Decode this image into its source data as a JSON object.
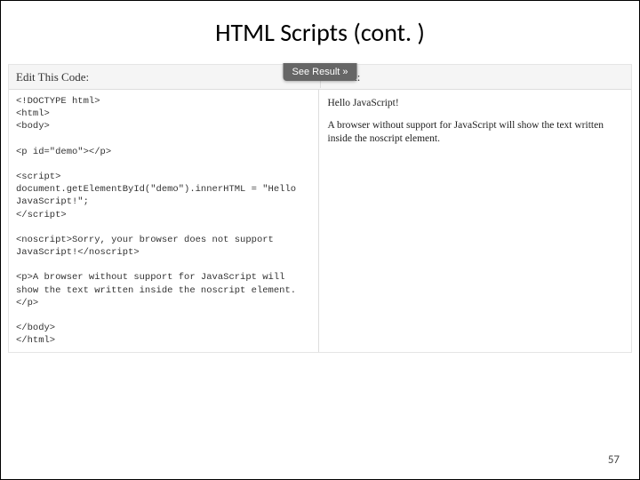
{
  "slide": {
    "title": "HTML Scripts (cont. )",
    "page_number": "57"
  },
  "editor": {
    "edit_label": "Edit This Code:",
    "result_label": "Result:",
    "see_result_button": "See Result »",
    "code": "<!DOCTYPE html>\n<html>\n<body>\n\n<p id=\"demo\"></p>\n\n<script>\ndocument.getElementById(\"demo\").innerHTML = \"Hello JavaScript!\";\n</script>\n\n<noscript>Sorry, your browser does not support JavaScript!</noscript>\n\n<p>A browser without support for JavaScript will show the text written inside the noscript element.</p>\n\n</body>\n</html>",
    "result": {
      "line1": "Hello JavaScript!",
      "line2": "A browser without support for JavaScript will show the text written inside the noscript element."
    }
  }
}
